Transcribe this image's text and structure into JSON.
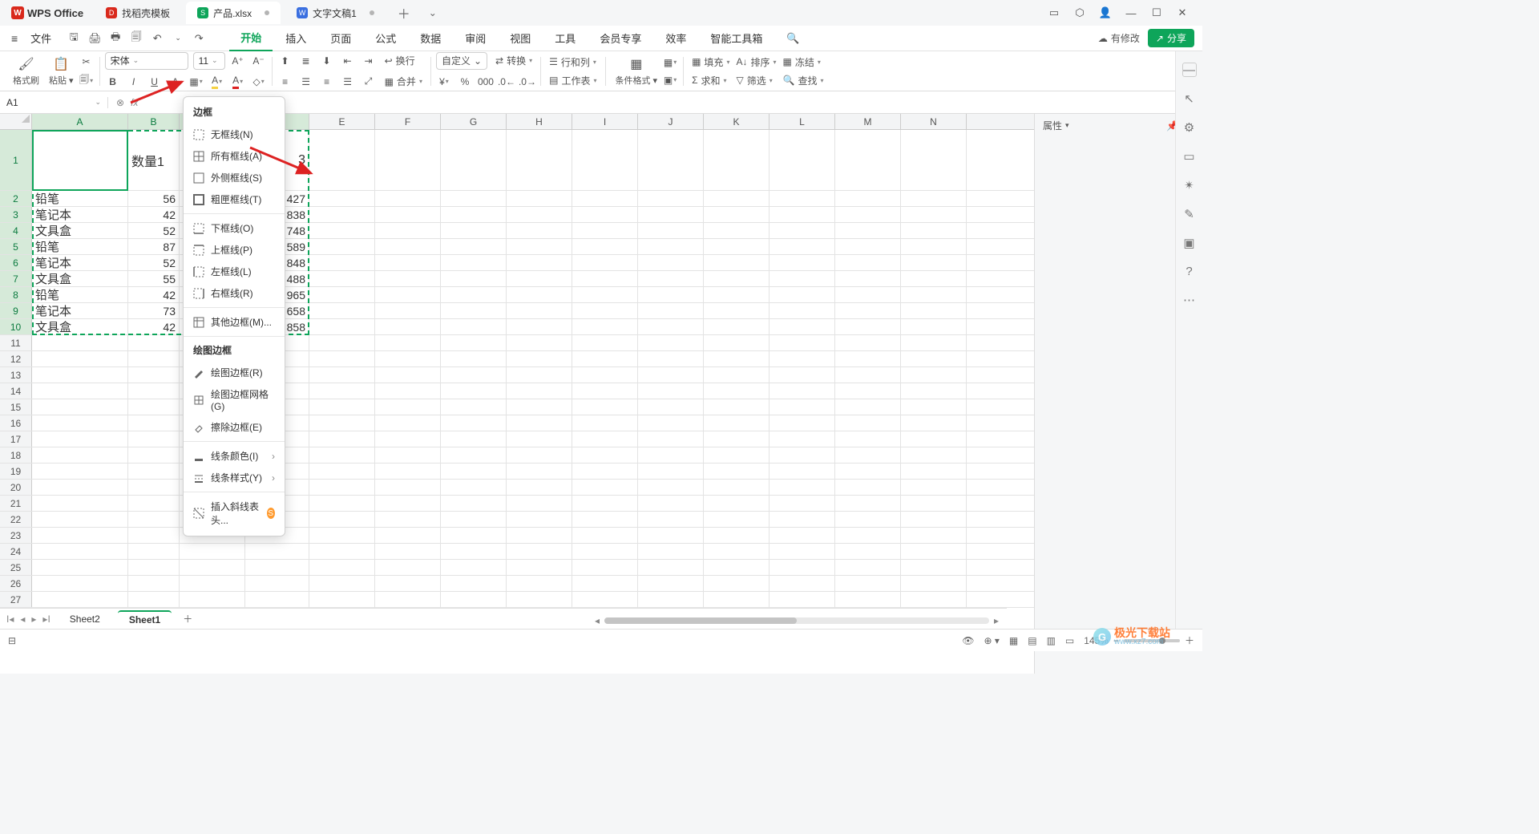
{
  "title_bar": {
    "brand": "WPS Office",
    "tabs": [
      {
        "label": "找稻壳模板",
        "icon": "doc"
      },
      {
        "label": "产品.xlsx",
        "icon": "sheet",
        "active": true,
        "dirty": true
      },
      {
        "label": "文字文稿1",
        "icon": "writer",
        "dirty": true
      }
    ]
  },
  "menu_bar": {
    "file": "文件",
    "items": [
      "开始",
      "插入",
      "页面",
      "公式",
      "数据",
      "审阅",
      "视图",
      "工具",
      "会员专享",
      "效率",
      "智能工具箱"
    ],
    "active_index": 0,
    "right": {
      "cloud": "有修改",
      "share": "分享"
    }
  },
  "ribbon": {
    "format_painter": "格式刷",
    "paste": "粘贴",
    "font_name": "宋体",
    "font_size": "11",
    "wrap": "换行",
    "merge": "合并",
    "custom": "自定义",
    "transform": "转换",
    "row_col": "行和列",
    "worksheet": "工作表",
    "cond_format": "条件格式",
    "fill": "填充",
    "sort": "排序",
    "freeze": "冻结",
    "sum": "求和",
    "filter": "筛选",
    "find": "查找"
  },
  "name_box": "A1",
  "columns": [
    "A",
    "B",
    "C",
    "D",
    "E",
    "F",
    "G",
    "H",
    "I",
    "J",
    "K",
    "L",
    "M",
    "N"
  ],
  "col_widths": {
    "A": 120,
    "B": 64,
    "D": 80,
    "other": 82
  },
  "row_heights": {
    "r1": 76,
    "other": 20
  },
  "header_row": {
    "B": "数量1",
    "D_tail": "3"
  },
  "data_rows": [
    {
      "A": "铅笔",
      "B": "56",
      "D": "427"
    },
    {
      "A": "笔记本",
      "B": "42",
      "D": "838"
    },
    {
      "A": "文具盒",
      "B": "52",
      "D": "748"
    },
    {
      "A": "铅笔",
      "B": "87",
      "D": "589"
    },
    {
      "A": "笔记本",
      "B": "52",
      "D": "848"
    },
    {
      "A": "文具盒",
      "B": "55",
      "D": "488"
    },
    {
      "A": "铅笔",
      "B": "42",
      "D": "965"
    },
    {
      "A": "笔记本",
      "B": "73",
      "D": "658"
    },
    {
      "A": "文具盒",
      "B": "42",
      "D": "858"
    }
  ],
  "selected_cols": [
    "A",
    "B",
    "C",
    "D"
  ],
  "selected_rows": [
    1,
    2,
    3,
    4,
    5,
    6,
    7,
    8,
    9,
    10
  ],
  "dropdown": {
    "section1_title": "边框",
    "section1_items": [
      {
        "label": "无框线(N)",
        "icon": "none"
      },
      {
        "label": "所有框线(A)",
        "icon": "all"
      },
      {
        "label": "外侧框线(S)",
        "icon": "outer"
      },
      {
        "label": "粗匣框线(T)",
        "icon": "thick"
      }
    ],
    "section2_items": [
      {
        "label": "下框线(O)",
        "icon": "bottom"
      },
      {
        "label": "上框线(P)",
        "icon": "top"
      },
      {
        "label": "左框线(L)",
        "icon": "left"
      },
      {
        "label": "右框线(R)",
        "icon": "right"
      }
    ],
    "section3_items": [
      {
        "label": "其他边框(M)...",
        "icon": "more"
      }
    ],
    "section4_title": "绘图边框",
    "section4_items": [
      {
        "label": "绘图边框(R)",
        "icon": "draw"
      },
      {
        "label": "绘图边框网格(G)",
        "icon": "grid"
      },
      {
        "label": "擦除边框(E)",
        "icon": "erase"
      }
    ],
    "section5_items": [
      {
        "label": "线条颜色(I)",
        "icon": "color",
        "submenu": true
      },
      {
        "label": "线条样式(Y)",
        "icon": "style",
        "submenu": true
      }
    ],
    "section6_items": [
      {
        "label": "插入斜线表头...",
        "icon": "diag",
        "badge": "S"
      }
    ]
  },
  "right_panel": {
    "title": "属性"
  },
  "sheet_tabs": [
    "Sheet2",
    "Sheet1"
  ],
  "sheet_active_index": 1,
  "status_bar": {
    "zoom": "145%"
  },
  "watermark": {
    "main": "极光下载站",
    "sub": "www.xz7.com"
  }
}
